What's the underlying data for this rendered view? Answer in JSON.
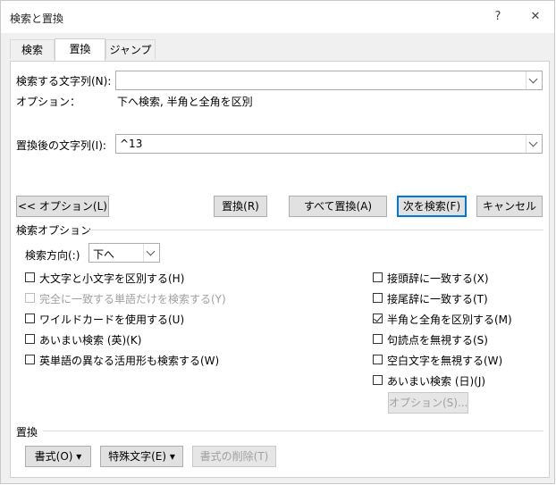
{
  "window": {
    "title": "検索と置換",
    "help": "?",
    "close": "✕"
  },
  "tabs": [
    {
      "label": "検索"
    },
    {
      "label": "置換"
    },
    {
      "label": "ジャンプ"
    }
  ],
  "find": {
    "label": "検索する文字列(N):",
    "value": ""
  },
  "options_line": {
    "label": "オプション：",
    "value": "下へ検索, 半角と全角を区別"
  },
  "replace": {
    "label": "置換後の文字列(I):",
    "value": "^13"
  },
  "buttons": {
    "options_toggle": "<< オプション(L)",
    "replace": "置換(R)",
    "replace_all": "すべて置換(A)",
    "find_next": "次を検索(F)",
    "cancel": "キャンセル"
  },
  "search_options": {
    "heading": "検索オプション",
    "direction_label": "検索方向(:)",
    "direction_value": "下へ",
    "left": [
      {
        "label": "大文字と小文字を区別する(H)",
        "checked": false,
        "disabled": false
      },
      {
        "label": "完全に一致する単語だけを検索する(Y)",
        "checked": false,
        "disabled": true
      },
      {
        "label": "ワイルドカードを使用する(U)",
        "checked": false,
        "disabled": false
      },
      {
        "label": "あいまい検索 (英)(K)",
        "checked": false,
        "disabled": false
      },
      {
        "label": "英単語の異なる活用形も検索する(W)",
        "checked": false,
        "disabled": false
      }
    ],
    "right": [
      {
        "label": "接頭辞に一致する(X)",
        "checked": false,
        "disabled": false
      },
      {
        "label": "接尾辞に一致する(T)",
        "checked": false,
        "disabled": false
      },
      {
        "label": "半角と全角を区別する(M)",
        "checked": true,
        "disabled": false
      },
      {
        "label": "句読点を無視する(S)",
        "checked": false,
        "disabled": false
      },
      {
        "label": "空白文字を無視する(W)",
        "checked": false,
        "disabled": false
      },
      {
        "label": "あいまい検索 (日)(J)",
        "checked": false,
        "disabled": false
      }
    ],
    "fuzzy_options_button": "オプション(S)..."
  },
  "replace_section": {
    "heading": "置換",
    "format_button": "書式(O)",
    "special_button": "特殊文字(E)",
    "clear_format_button": "書式の削除(T)"
  }
}
